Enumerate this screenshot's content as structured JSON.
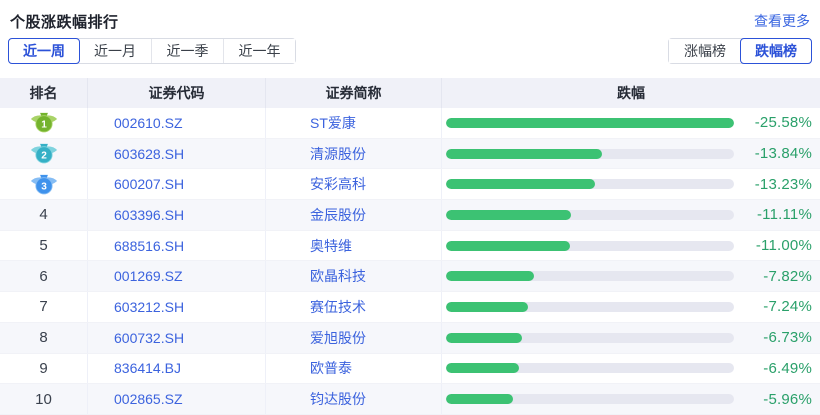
{
  "title": "个股涨跌幅排行",
  "more_link": "查看更多",
  "period_tabs": [
    {
      "key": "week",
      "label": "近一周",
      "active": true
    },
    {
      "key": "month",
      "label": "近一月",
      "active": false
    },
    {
      "key": "quarter",
      "label": "近一季",
      "active": false
    },
    {
      "key": "year",
      "label": "近一年",
      "active": false
    }
  ],
  "board_tabs": [
    {
      "key": "gainers",
      "label": "涨幅榜",
      "active": false
    },
    {
      "key": "losers",
      "label": "跌幅榜",
      "active": true
    }
  ],
  "table": {
    "headers": [
      "排名",
      "证券代码",
      "证券简称",
      "跌幅"
    ],
    "bar_max": 25.58,
    "rows": [
      {
        "rank": 1,
        "code": "002610.SZ",
        "name": "ST爱康",
        "pct": "-25.58%",
        "value": -25.58
      },
      {
        "rank": 2,
        "code": "603628.SH",
        "name": "清源股份",
        "pct": "-13.84%",
        "value": -13.84
      },
      {
        "rank": 3,
        "code": "600207.SH",
        "name": "安彩高科",
        "pct": "-13.23%",
        "value": -13.23
      },
      {
        "rank": 4,
        "code": "603396.SH",
        "name": "金辰股份",
        "pct": "-11.11%",
        "value": -11.11
      },
      {
        "rank": 5,
        "code": "688516.SH",
        "name": "奥特维",
        "pct": "-11.00%",
        "value": -11.0
      },
      {
        "rank": 6,
        "code": "001269.SZ",
        "name": "欧晶科技",
        "pct": "-7.82%",
        "value": -7.82
      },
      {
        "rank": 7,
        "code": "603212.SH",
        "name": "赛伍技术",
        "pct": "-7.24%",
        "value": -7.24
      },
      {
        "rank": 8,
        "code": "600732.SH",
        "name": "爱旭股份",
        "pct": "-6.73%",
        "value": -6.73
      },
      {
        "rank": 9,
        "code": "836414.BJ",
        "name": "欧普泰",
        "pct": "-6.49%",
        "value": -6.49
      },
      {
        "rank": 10,
        "code": "002865.SZ",
        "name": "钧达股份",
        "pct": "-5.96%",
        "value": -5.96
      }
    ]
  },
  "chart_data": {
    "type": "bar",
    "title": "跌幅",
    "categories": [
      "ST爱康",
      "清源股份",
      "安彩高科",
      "金辰股份",
      "奥特维",
      "欧晶科技",
      "赛伍技术",
      "爱旭股份",
      "欧普泰",
      "钧达股份"
    ],
    "values": [
      -25.58,
      -13.84,
      -13.23,
      -11.11,
      -11.0,
      -7.82,
      -7.24,
      -6.73,
      -6.49,
      -5.96
    ],
    "xlabel": "",
    "ylabel": "跌幅 (%)",
    "xlim": [
      -25.58,
      0
    ]
  },
  "colors": {
    "accent_blue": "#2c52d8",
    "link_blue": "#3a66e0",
    "code_blue": "#3c63de",
    "bar_green": "#3cc273",
    "pct_green": "#2aa06a",
    "bar_track": "#e6e7f0",
    "header_bg": "#f0f1f8",
    "stripe_bg": "#f6f7fb",
    "medals": {
      "1": {
        "wing": "#a9d368",
        "body": "#74b32d"
      },
      "2": {
        "wing": "#7fd3de",
        "body": "#35b0c6"
      },
      "3": {
        "wing": "#86bdf4",
        "body": "#3f92ec"
      }
    }
  }
}
